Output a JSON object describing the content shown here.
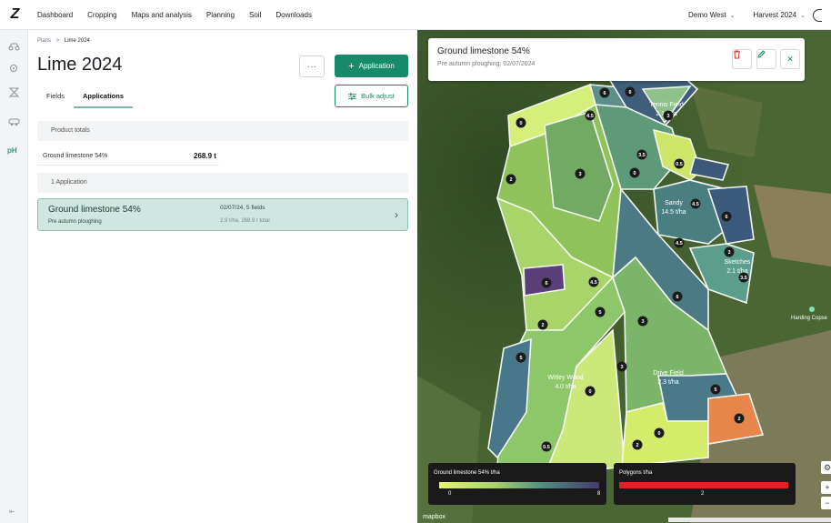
{
  "topbar": {
    "logo": "Z",
    "nav": [
      "Dashboard",
      "Cropping",
      "Maps and analysis",
      "Planning",
      "Soil",
      "Downloads"
    ],
    "farm_select": "Demo West",
    "harvest_select": "Harvest 2024"
  },
  "leftrail": {
    "ph_label": "pH"
  },
  "breadcrumb": {
    "parent": "Plans",
    "separator": ">",
    "current": "Lime 2024"
  },
  "page": {
    "title": "Lime 2024",
    "more_label": "···",
    "add_application_label": "Application",
    "bulk_adjust_label": "Bulk adjust"
  },
  "tabs": [
    {
      "label": "Fields",
      "active": false
    },
    {
      "label": "Applications",
      "active": true
    }
  ],
  "product_totals": {
    "header": "Product totals",
    "rows": [
      {
        "name": "Ground limestone 54%",
        "value": "268.9 t"
      }
    ]
  },
  "applications": {
    "header": "1 Application",
    "items": [
      {
        "product": "Ground limestone 54%",
        "operation": "Pre autumn ploughing",
        "date_fields": "02/07/24, 5 fields",
        "rate_total": "2.9 t/ha, 268.9 t total"
      }
    ]
  },
  "map": {
    "info_title": "Ground limestone 54%",
    "info_subtitle": "Pre autumn ploughing, 02/07/2024",
    "field_labels": [
      {
        "name": "Tennis Field",
        "rate": "2.1 t/ha"
      },
      {
        "name": "Sandy",
        "rate": "14.5 t/ha"
      },
      {
        "name": "Sketches",
        "rate": "2.1 t/ha"
      },
      {
        "name": "Witley Wood",
        "rate": "4.0 t/ha"
      },
      {
        "name": "Drive Field",
        "rate": "2.3 t/ha"
      }
    ],
    "zone_values": [
      "6",
      "3",
      "0",
      "4.5",
      "3",
      "3.5",
      "0.5",
      "2",
      "0",
      "4.5",
      "6",
      "4.5",
      "3",
      "3.5",
      "6",
      "4.5",
      "6",
      "5",
      "3",
      "2",
      "5",
      "3",
      "0",
      "5",
      "2",
      "0",
      "0.5",
      "2",
      "6"
    ],
    "place_label": "Harding Copse",
    "legend_limestone": {
      "title": "Ground limestone 54% t/ha",
      "min": "0",
      "max": "8"
    },
    "legend_polygons": {
      "title": "Polygons t/ha",
      "value": "2"
    },
    "attribution": "mapbox",
    "controls": [
      "⚙",
      "+",
      "−"
    ]
  }
}
